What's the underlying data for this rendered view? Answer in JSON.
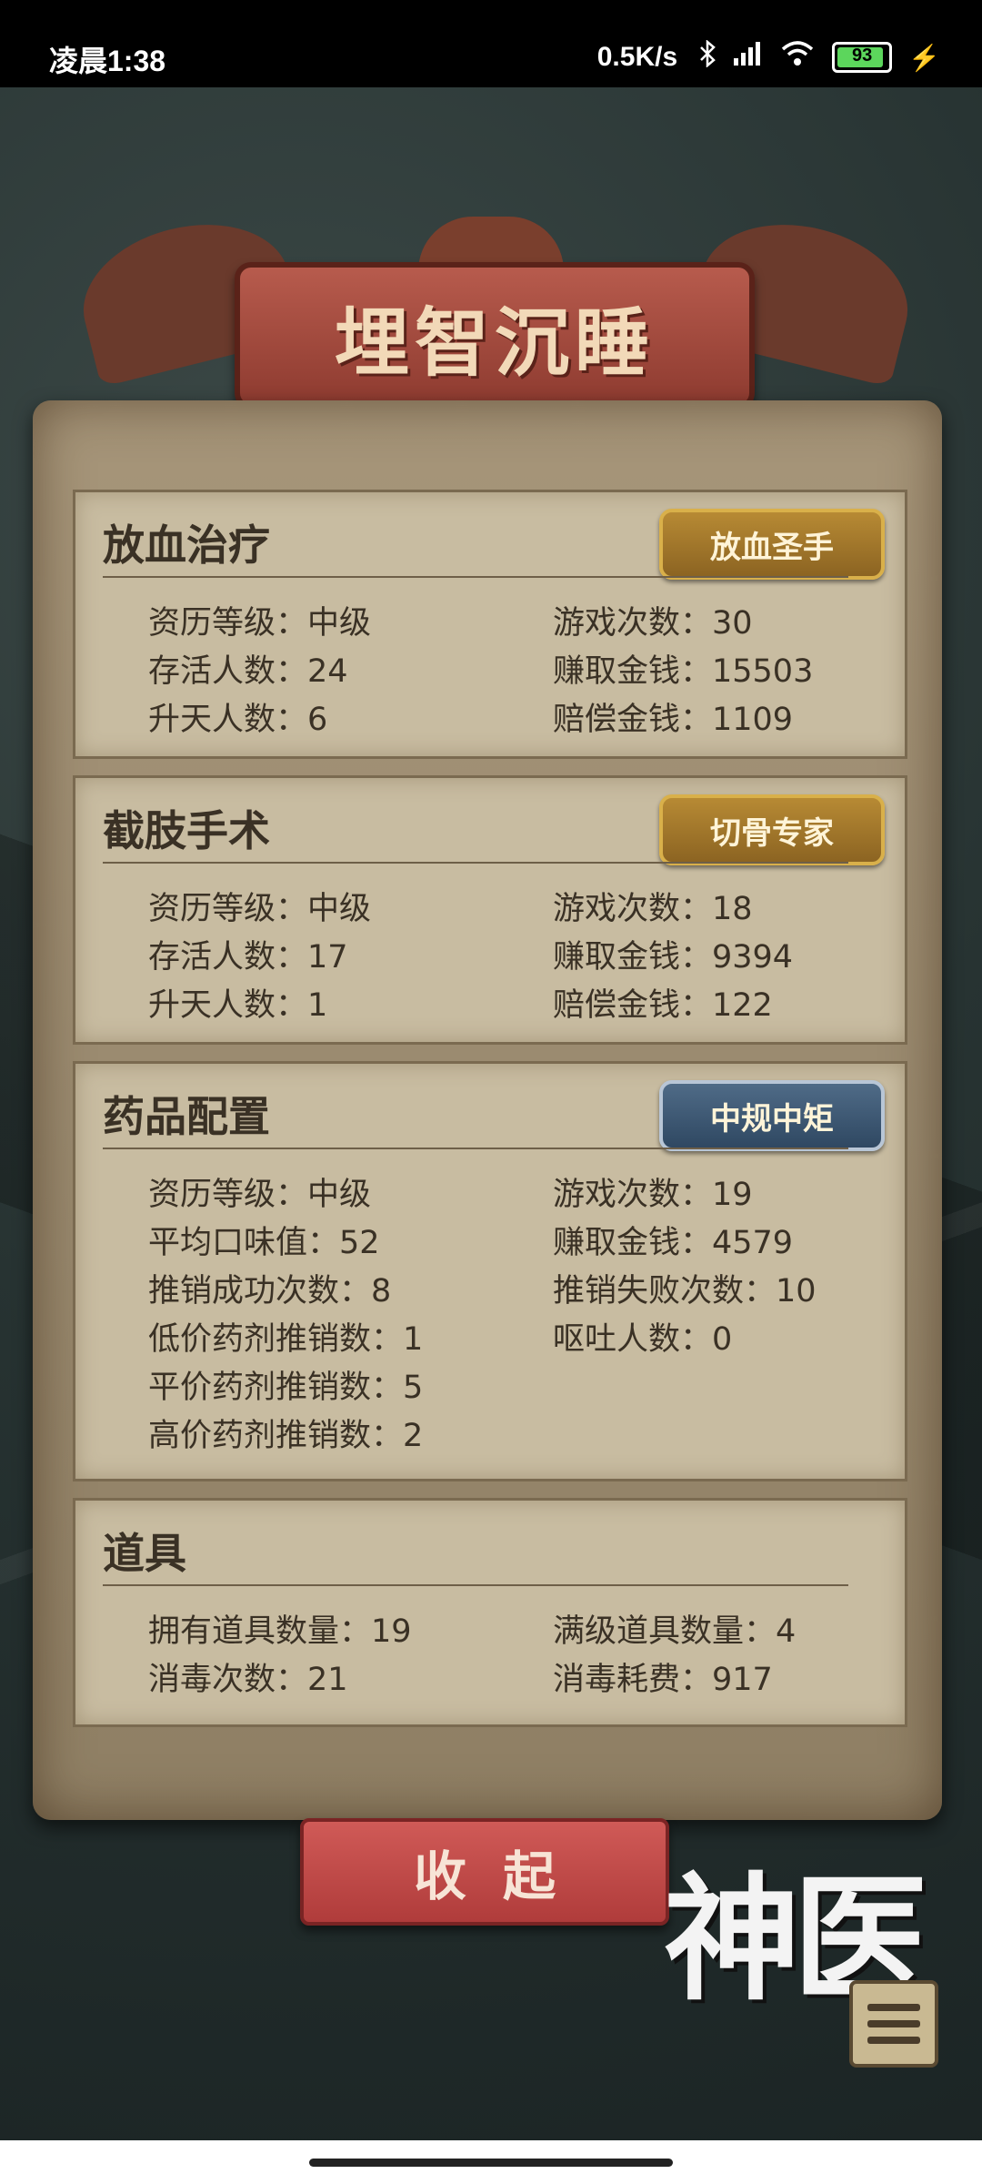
{
  "status_bar": {
    "time": "凌晨1:38",
    "speed": "0.5K/s",
    "battery": "93",
    "icons": [
      "bluetooth-icon",
      "signal-icon",
      "wifi-icon",
      "battery-icon",
      "charging-icon"
    ]
  },
  "title": "埋智沉睡",
  "sections": [
    {
      "title": "放血治疗",
      "badge": "放血圣手",
      "rows": [
        [
          "资历等级：中级",
          "游戏次数：30"
        ],
        [
          "存活人数：24",
          "赚取金钱：15503"
        ],
        [
          "升天人数：6",
          "赔偿金钱：1109"
        ]
      ]
    },
    {
      "title": "截肢手术",
      "badge": "切骨专家",
      "rows": [
        [
          "资历等级：中级",
          "游戏次数：18"
        ],
        [
          "存活人数：17",
          "赚取金钱：9394"
        ],
        [
          "升天人数：1",
          "赔偿金钱：122"
        ]
      ]
    },
    {
      "title": "药品配置",
      "badge": "中规中矩",
      "rows": [
        [
          "资历等级：中级",
          "游戏次数：19"
        ],
        [
          "平均口味值：52",
          "赚取金钱：4579"
        ],
        [
          "推销成功次数：8",
          "推销失败次数：10"
        ],
        [
          "低价药剂推销数：1",
          "呕吐人数：0"
        ],
        [
          "平价药剂推销数：5",
          ""
        ],
        [
          "高价药剂推销数：2",
          ""
        ]
      ]
    },
    {
      "title": "道具",
      "rows": [
        [
          "拥有道具数量：19",
          "满级道具数量：4"
        ],
        [
          "消毒次数：21",
          "消毒耗费：917"
        ]
      ]
    }
  ],
  "collapse_button": "收起",
  "logo_text": "神医",
  "colors": {
    "parchment": "#a69579",
    "section_bg": "#c8bca1",
    "banner": "#b75b4d",
    "button_red": "#d05a57",
    "badge_gold": "#b78a34",
    "badge_blue": "#4f6b87"
  }
}
